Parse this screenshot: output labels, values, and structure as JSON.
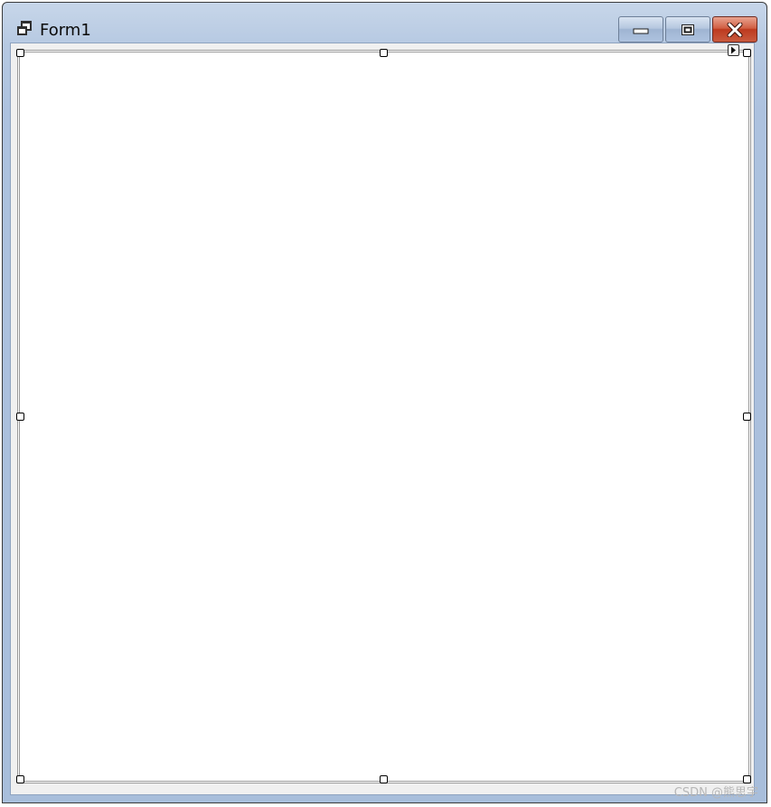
{
  "window": {
    "title": "Form1",
    "icon": "form-icon",
    "buttons": {
      "minimize": "minimize-icon",
      "maximize": "maximize-icon",
      "close": "close-icon"
    },
    "colors": {
      "titlebar": "#b6c9e2",
      "close_button": "#c9442a",
      "canvas": "#ffffff",
      "client": "#f0f0f0"
    }
  },
  "designer": {
    "selected_control": "empty-control-selection",
    "smart_tag_icon": "smart-tag-arrow-icon"
  },
  "watermark": {
    "text": "CSDN @熊思宇"
  }
}
